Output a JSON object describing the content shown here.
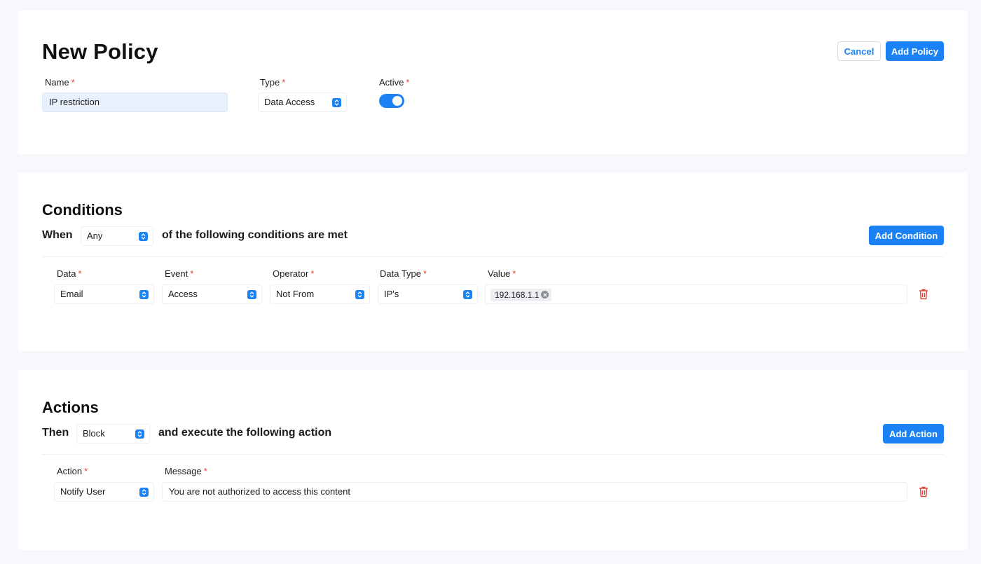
{
  "policy": {
    "title": "New Policy",
    "cancel_label": "Cancel",
    "add_policy_label": "Add Policy",
    "name_label": "Name",
    "name_value": "IP restriction",
    "type_label": "Type",
    "type_value": "Data Access",
    "active_label": "Active",
    "active_on": true,
    "required_mark": "*"
  },
  "conditions": {
    "title": "Conditions",
    "when_label": "When",
    "match_value": "Any",
    "suffix": "of the following conditions are met",
    "add_label": "Add Condition",
    "columns": {
      "data": "Data",
      "event": "Event",
      "operator": "Operator",
      "data_type": "Data Type",
      "value": "Value"
    },
    "row": {
      "data": "Email",
      "event": "Access",
      "operator": "Not From",
      "data_type": "IP's",
      "value_chip": "192.168.1.1"
    }
  },
  "actions": {
    "title": "Actions",
    "then_label": "Then",
    "mode_value": "Block",
    "suffix": "and execute the following action",
    "add_label": "Add Action",
    "columns": {
      "action": "Action",
      "message": "Message"
    },
    "row": {
      "action": "Notify User",
      "message": "You are not authorized to access this content"
    }
  },
  "colors": {
    "accent": "#1a82f5",
    "required": "#e0453b",
    "delete": "#e0453b",
    "input_filled": "#e8f0fb"
  },
  "icons": {
    "select": "chevron-updown-icon",
    "chip_remove": "close-circle-icon",
    "delete": "trash-icon"
  }
}
